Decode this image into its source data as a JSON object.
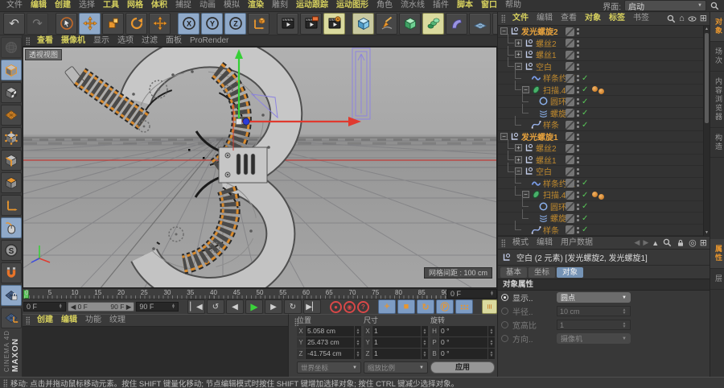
{
  "menubar": {
    "items": [
      {
        "key": "file",
        "label": "文件",
        "hl": false
      },
      {
        "key": "edit",
        "label": "编辑",
        "hl": true
      },
      {
        "key": "create",
        "label": "创建",
        "hl": true
      },
      {
        "key": "select",
        "label": "选择",
        "hl": false
      },
      {
        "key": "tools",
        "label": "工具",
        "hl": true
      },
      {
        "key": "mesh",
        "label": "网格",
        "hl": true
      },
      {
        "key": "volume",
        "label": "体积",
        "hl": true
      },
      {
        "key": "snap",
        "label": "捕捉",
        "hl": false
      },
      {
        "key": "animate",
        "label": "动画",
        "hl": false
      },
      {
        "key": "simulate",
        "label": "模拟",
        "hl": false
      },
      {
        "key": "render",
        "label": "渲染",
        "hl": true
      },
      {
        "key": "sculpt",
        "label": "雕刻",
        "hl": false
      },
      {
        "key": "motion-tracker",
        "label": "运动跟踪",
        "hl": true
      },
      {
        "key": "mograph",
        "label": "运动图形",
        "hl": true
      },
      {
        "key": "character",
        "label": "角色",
        "hl": false
      },
      {
        "key": "pipeline",
        "label": "流水线",
        "hl": false
      },
      {
        "key": "plugins",
        "label": "插件",
        "hl": false
      },
      {
        "key": "script",
        "label": "脚本",
        "hl": true
      },
      {
        "key": "window",
        "label": "窗口",
        "hl": true
      },
      {
        "key": "help",
        "label": "帮助",
        "hl": false
      }
    ],
    "interface_label": "界面:",
    "interface_value": "启动"
  },
  "toolbar": [
    {
      "name": "undo-button",
      "icon": "undo"
    },
    {
      "name": "redo-button",
      "icon": "redo",
      "state": "disabled"
    },
    {
      "sep": true
    },
    {
      "name": "live-selection-button",
      "icon": "cursor"
    },
    {
      "name": "move-tool-button",
      "icon": "move",
      "state": "active-blue"
    },
    {
      "name": "scale-tool-button",
      "icon": "scale"
    },
    {
      "name": "rotate-tool-button",
      "icon": "rotate"
    },
    {
      "name": "last-tool-button",
      "icon": "move"
    },
    {
      "sep": true
    },
    {
      "name": "x-axis-lock-button",
      "icon": "axisX",
      "state": "active-blue"
    },
    {
      "name": "y-axis-lock-button",
      "icon": "axisY",
      "state": "active-blue"
    },
    {
      "name": "z-axis-lock-button",
      "icon": "axisZ",
      "state": "active-blue"
    },
    {
      "name": "coordinate-system-button",
      "icon": "coordsys"
    },
    {
      "sep": true
    },
    {
      "name": "render-view-button",
      "icon": "clapper"
    },
    {
      "name": "render-picture-viewer-button",
      "icon": "clapperPv"
    },
    {
      "name": "render-settings-button",
      "icon": "clapperGear",
      "state": "active-yellow"
    },
    {
      "sep": true
    },
    {
      "name": "add-primitive-button",
      "icon": "cubeBlue",
      "state": "framed"
    },
    {
      "name": "spline-pen-button",
      "icon": "pen"
    },
    {
      "name": "subdivision-surface-button",
      "icon": "cubeGreen"
    },
    {
      "name": "generators-button",
      "icon": "sweep",
      "state": "active-yellow"
    },
    {
      "name": "deformers-button",
      "icon": "bend"
    },
    {
      "name": "environment-button",
      "icon": "floor"
    },
    {
      "name": "camera-button",
      "icon": "camera"
    },
    {
      "name": "light-button",
      "icon": "bulb"
    }
  ],
  "left_toolbar": [
    {
      "name": "make-editable-button",
      "icon": "sphereGray",
      "state": "disabled"
    },
    {
      "name": "model-mode-button",
      "icon": "cubeGray",
      "state": "active-blue"
    },
    {
      "name": "texture-mode-button",
      "icon": "cubeChecker"
    },
    {
      "name": "workplane-mode-button",
      "icon": "gridOrange"
    },
    {
      "name": "points-mode-button",
      "icon": "cubePoints"
    },
    {
      "name": "edges-mode-button",
      "icon": "cubeEdges"
    },
    {
      "name": "polygons-mode-button",
      "icon": "cubePolys"
    },
    {
      "name": "enable-axis-button",
      "icon": "axisL"
    },
    {
      "name": "tweak-mode-button",
      "icon": "mouse",
      "state": "active-blue"
    },
    {
      "name": "snap-settings-button",
      "icon": "snapS"
    },
    {
      "name": "magnet-button",
      "icon": "magnet"
    },
    {
      "name": "lock-workplane-button",
      "icon": "gridLock",
      "state": "active-blue"
    },
    {
      "name": "workplane-axis-button",
      "icon": "gridAxis"
    }
  ],
  "viewport": {
    "menu": [
      {
        "key": "view",
        "label": "查看",
        "hl": true
      },
      {
        "key": "cameras",
        "label": "摄像机",
        "hl": true
      },
      {
        "key": "display",
        "label": "显示",
        "hl": false
      },
      {
        "key": "options",
        "label": "选项",
        "hl": false
      },
      {
        "key": "filter",
        "label": "过滤",
        "hl": false
      },
      {
        "key": "panel",
        "label": "面板",
        "hl": false
      },
      {
        "key": "prorender",
        "label": "ProRender",
        "hl": false
      }
    ],
    "view_label": "透视视图",
    "grid_label": "网格间距 : 100 cm"
  },
  "timeline": {
    "ticks": [
      0,
      5,
      10,
      15,
      20,
      25,
      30,
      35,
      40,
      45,
      50,
      55,
      60,
      65,
      70,
      75,
      80,
      85,
      90
    ],
    "ruler_frame": "0 F",
    "current_frame": "0 F",
    "range_start": "0 F",
    "range_end": "90 F",
    "end_frame": "90 F",
    "transport": [
      "goto-start-button",
      "play-reverse-button",
      "previous-frame-button",
      "play-button",
      "next-frame-button",
      "play-cycle-button",
      "goto-end-button"
    ],
    "key_buttons": [
      "record-keyframe-button",
      "autokeying-button",
      "keyframe-options-button"
    ],
    "record_toggles": [
      "record-position-button",
      "record-scale-button",
      "record-rotation-button",
      "record-parameter-button",
      "record-pla-button"
    ],
    "extra_button": "timeline-options-button"
  },
  "materials": {
    "menu": [
      {
        "key": "create",
        "label": "创建",
        "hl": true
      },
      {
        "key": "edit",
        "label": "编辑",
        "hl": true
      },
      {
        "key": "function",
        "label": "功能",
        "hl": false
      },
      {
        "key": "texture",
        "label": "纹理",
        "hl": false
      }
    ]
  },
  "coords": {
    "columns": [
      {
        "name": "position",
        "header": "位置",
        "fields": [
          {
            "k": "X",
            "v": "5.058 cm"
          },
          {
            "k": "Y",
            "v": "25.473 cm"
          },
          {
            "k": "Z",
            "v": "-41.754 cm"
          }
        ],
        "footer": "世界坐标",
        "footer_type": "dropdown"
      },
      {
        "name": "size",
        "header": "尺寸",
        "fields": [
          {
            "k": "X",
            "v": "1"
          },
          {
            "k": "Y",
            "v": "1"
          },
          {
            "k": "Z",
            "v": "1"
          }
        ],
        "footer": "缩放比例",
        "footer_type": "dropdown"
      },
      {
        "name": "rotation",
        "header": "旋转",
        "fields": [
          {
            "k": "H",
            "v": "0 °"
          },
          {
            "k": "P",
            "v": "0 °"
          },
          {
            "k": "B",
            "v": "0 °"
          }
        ],
        "footer": "应用",
        "footer_type": "button"
      }
    ]
  },
  "status": "移动: 点击并拖动鼠标移动元素。按住 SHIFT 键量化移动; 节点编辑模式时按住 SHIFT 键增加选择对象; 按住 CTRL 键减少选择对象。",
  "object_manager": {
    "menu": [
      {
        "key": "file",
        "label": "文件",
        "hl": true
      },
      {
        "key": "edit",
        "label": "编辑",
        "hl": false
      },
      {
        "key": "view",
        "label": "查看",
        "hl": false
      },
      {
        "key": "objects",
        "label": "对象",
        "hl": true
      },
      {
        "key": "tags",
        "label": "标签",
        "hl": true
      },
      {
        "key": "bookmarks",
        "label": "书签",
        "hl": false
      }
    ],
    "tree": [
      {
        "label": "发光螺旋2",
        "icon": "null",
        "level": 0,
        "expander": "minus",
        "root": true
      },
      {
        "label": "螺丝2",
        "icon": "null",
        "level": 1,
        "expander": "plus"
      },
      {
        "label": "螺丝1",
        "icon": "null",
        "level": 1,
        "expander": "plus"
      },
      {
        "label": "空白",
        "icon": "null",
        "level": 1,
        "expander": "minus"
      },
      {
        "label": "样条约束",
        "icon": "constraint",
        "level": 2,
        "check": true
      },
      {
        "label": "扫描.4",
        "icon": "sweep",
        "level": 2,
        "expander": "minus",
        "check": true,
        "tags": 2
      },
      {
        "label": "圆环",
        "icon": "circle",
        "level": 3,
        "check": true
      },
      {
        "label": "螺旋",
        "icon": "helix",
        "level": 3,
        "check": true
      },
      {
        "label": "样条",
        "icon": "spline",
        "level": 2,
        "check": true
      },
      {
        "label": "发光螺旋1",
        "icon": "null",
        "level": 0,
        "expander": "minus",
        "root": true
      },
      {
        "label": "螺丝2",
        "icon": "null",
        "level": 1,
        "expander": "plus"
      },
      {
        "label": "螺丝1",
        "icon": "null",
        "level": 1,
        "expander": "plus"
      },
      {
        "label": "空白",
        "icon": "null",
        "level": 1,
        "expander": "minus"
      },
      {
        "label": "样条约束",
        "icon": "constraint",
        "level": 2,
        "check": true
      },
      {
        "label": "扫描.4",
        "icon": "sweep",
        "level": 2,
        "expander": "minus",
        "check": true,
        "tags": 2
      },
      {
        "label": "圆环",
        "icon": "circle",
        "level": 3,
        "check": true
      },
      {
        "label": "螺旋",
        "icon": "helix",
        "level": 3,
        "check": true
      },
      {
        "label": "样条",
        "icon": "spline",
        "level": 2,
        "check": true
      }
    ]
  },
  "right_tabs": {
    "top": [
      {
        "name": "tab-objects",
        "label": "对象",
        "active": true
      },
      {
        "name": "tab-takes",
        "label": "场次",
        "active": false
      },
      {
        "name": "tab-content-browser",
        "label": "内容浏览器",
        "active": false
      },
      {
        "name": "tab-structure",
        "label": "构造",
        "active": false
      }
    ],
    "bottom": [
      {
        "name": "tab-attributes",
        "label": "属性",
        "active": true
      },
      {
        "name": "tab-layers",
        "label": "层",
        "active": false
      }
    ]
  },
  "attributes": {
    "menu": [
      {
        "key": "mode",
        "label": "模式"
      },
      {
        "key": "edit",
        "label": "编辑"
      },
      {
        "key": "user-data",
        "label": "用户数据"
      }
    ],
    "title": "空白 (2 元素) [发光螺旋2, 发光螺旋1]",
    "tabs": [
      {
        "name": "tab-basic",
        "label": "基本",
        "active": false
      },
      {
        "name": "tab-coord",
        "label": "坐标",
        "active": false
      },
      {
        "name": "tab-object",
        "label": "对象",
        "active": true
      }
    ],
    "section": "对象属性",
    "rows": [
      {
        "name": "display-property",
        "label": "显示..",
        "value": "圆点",
        "type": "dropdown",
        "enabled": true
      },
      {
        "name": "radius-property",
        "label": "半径..",
        "value": "10 cm",
        "type": "stepper",
        "enabled": false
      },
      {
        "name": "aspect-ratio-property",
        "label": "宽高比",
        "value": "1",
        "type": "stepper",
        "enabled": false
      },
      {
        "name": "orientation-property",
        "label": "方向..",
        "value": "摄像机",
        "type": "dropdown",
        "enabled": false
      }
    ]
  }
}
